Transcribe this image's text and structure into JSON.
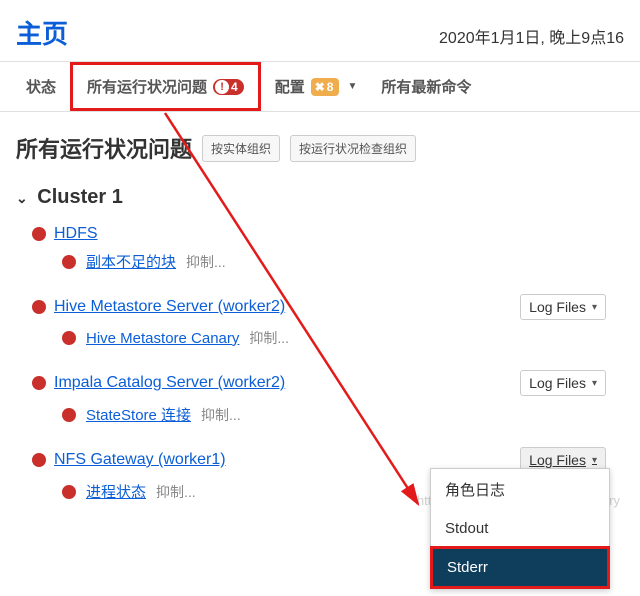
{
  "header": {
    "title": "主页",
    "timestamp": "2020年1月1日, 晚上9点16"
  },
  "tabs": {
    "status": "状态",
    "issues_label": "所有运行状况问题",
    "issues_count": "4",
    "config_label": "配置",
    "config_count": "8",
    "commands": "所有最新命令"
  },
  "sub": {
    "title": "所有运行状况问题",
    "btn_entity": "按实体组织",
    "btn_check": "按运行状况检查组织"
  },
  "cluster": {
    "name": "Cluster 1",
    "logfiles_label": "Log Files",
    "suppress": "抑制...",
    "services": [
      {
        "name": "HDFS",
        "sub": "副本不足的块"
      },
      {
        "name": "Hive Metastore Server (worker2)",
        "sub": "Hive Metastore Canary",
        "log": true
      },
      {
        "name": "Impala Catalog Server (worker2)",
        "sub": "StateStore 连接",
        "log": true
      },
      {
        "name": "NFS Gateway (worker1)",
        "sub": "进程状态",
        "log": true,
        "log_open": true
      }
    ]
  },
  "dropdown": {
    "role_log": "角色日志",
    "stdout": "Stdout",
    "stderr": "Stderr"
  },
  "watermark": "https://blog.csdn.net/boling_cavalry"
}
